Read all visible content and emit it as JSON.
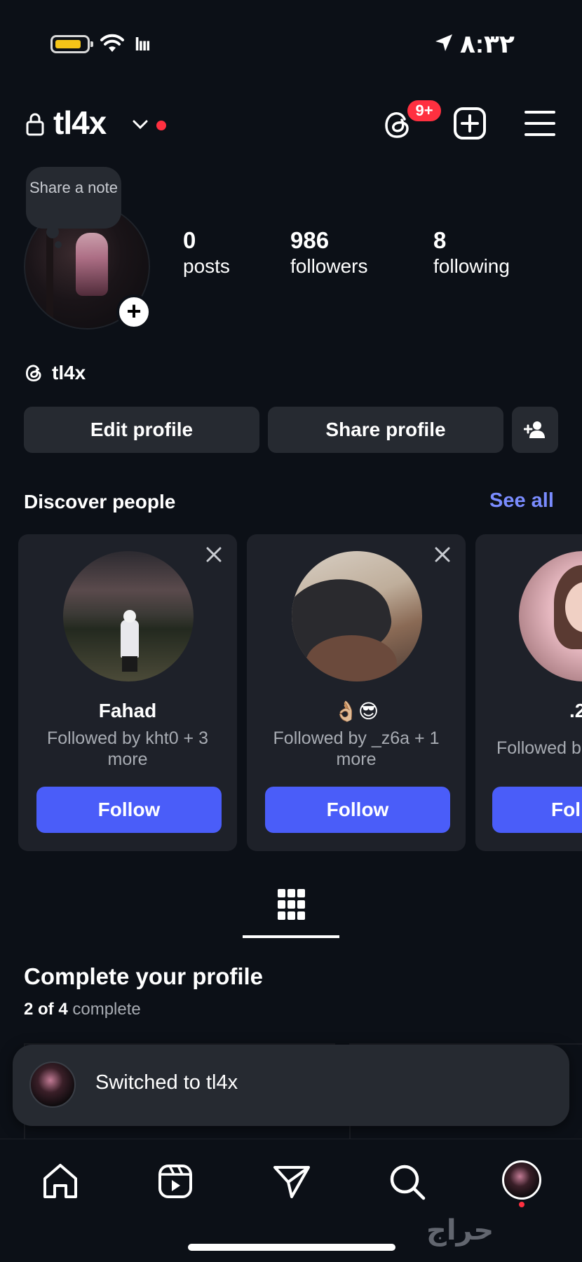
{
  "status_bar": {
    "time": "٨:٣٢",
    "signal_text": "lııı"
  },
  "header": {
    "username": "tl4x",
    "threads_badge": "9+"
  },
  "profile": {
    "note_text": "Share a note",
    "add_icon": "+",
    "stats": {
      "posts": {
        "value": "0",
        "label": "posts"
      },
      "followers": {
        "value": "986",
        "label": "followers"
      },
      "following": {
        "value": "8",
        "label": "following"
      }
    },
    "threads_handle": "tl4x"
  },
  "actions": {
    "edit_profile": "Edit profile",
    "share_profile": "Share profile"
  },
  "discover": {
    "title": "Discover people",
    "see_all": "See all",
    "cards": [
      {
        "name": "Fahad",
        "subtitle": "Followed by kht0 + 3 more",
        "follow": "Follow"
      },
      {
        "name": "👌🏼😎",
        "subtitle": "Followed by _z6a + 1 more",
        "follow": "Follow"
      },
      {
        "name": ".2",
        "subtitle": "Followed b",
        "follow": "Fol"
      }
    ]
  },
  "complete_profile": {
    "title": "Complete your profile",
    "progress_strong": "2 of 4",
    "progress_rest": "complete"
  },
  "toast": {
    "text": "Switched to tl4x"
  },
  "watermark": "حراج",
  "colors": {
    "background": "#0c1017",
    "button": "#262a31",
    "accent_blue": "#4a5df9",
    "link_blue": "#7a8cff",
    "badge_red": "#ff3040"
  },
  "icons": [
    "battery-icon",
    "wifi-icon",
    "location-icon",
    "lock-icon",
    "chevron-down-icon",
    "threads-icon",
    "plus-square-icon",
    "menu-icon",
    "add-person-icon",
    "close-icon",
    "grid-icon",
    "home-icon",
    "reels-icon",
    "send-icon",
    "search-icon"
  ]
}
